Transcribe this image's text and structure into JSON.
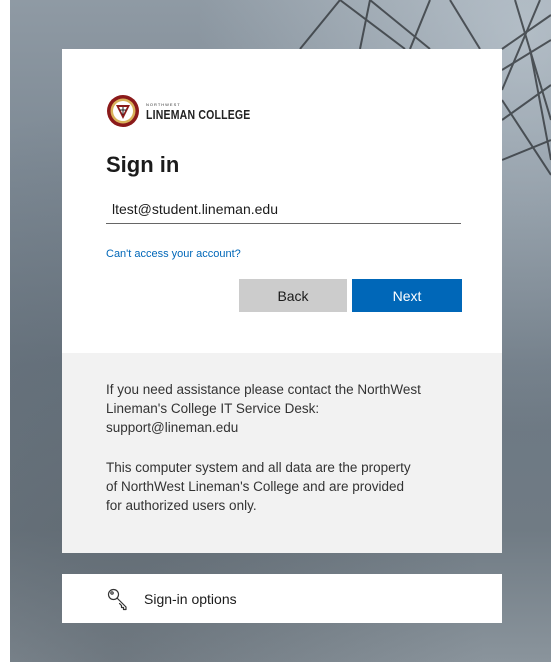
{
  "brand": {
    "logo_small_text": "NORTHWEST",
    "logo_name": "LINEMAN COLLEGE",
    "accent_color": "#0067b8",
    "seal_color": "#8b1a1a"
  },
  "signin": {
    "title": "Sign in",
    "username_value": "ltest@student.lineman.edu",
    "cant_access_link": "Can't access your account?",
    "back_label": "Back",
    "next_label": "Next"
  },
  "info": {
    "assistance_text": "If you need assistance please contact the NorthWest\nLineman's College IT Service Desk:\nsupport@lineman.edu",
    "property_text": "This computer system and all data are the property\nof NorthWest Lineman's College and are provided\nfor authorized users only."
  },
  "signin_options": {
    "label": "Sign-in options",
    "icon": "key-icon"
  }
}
